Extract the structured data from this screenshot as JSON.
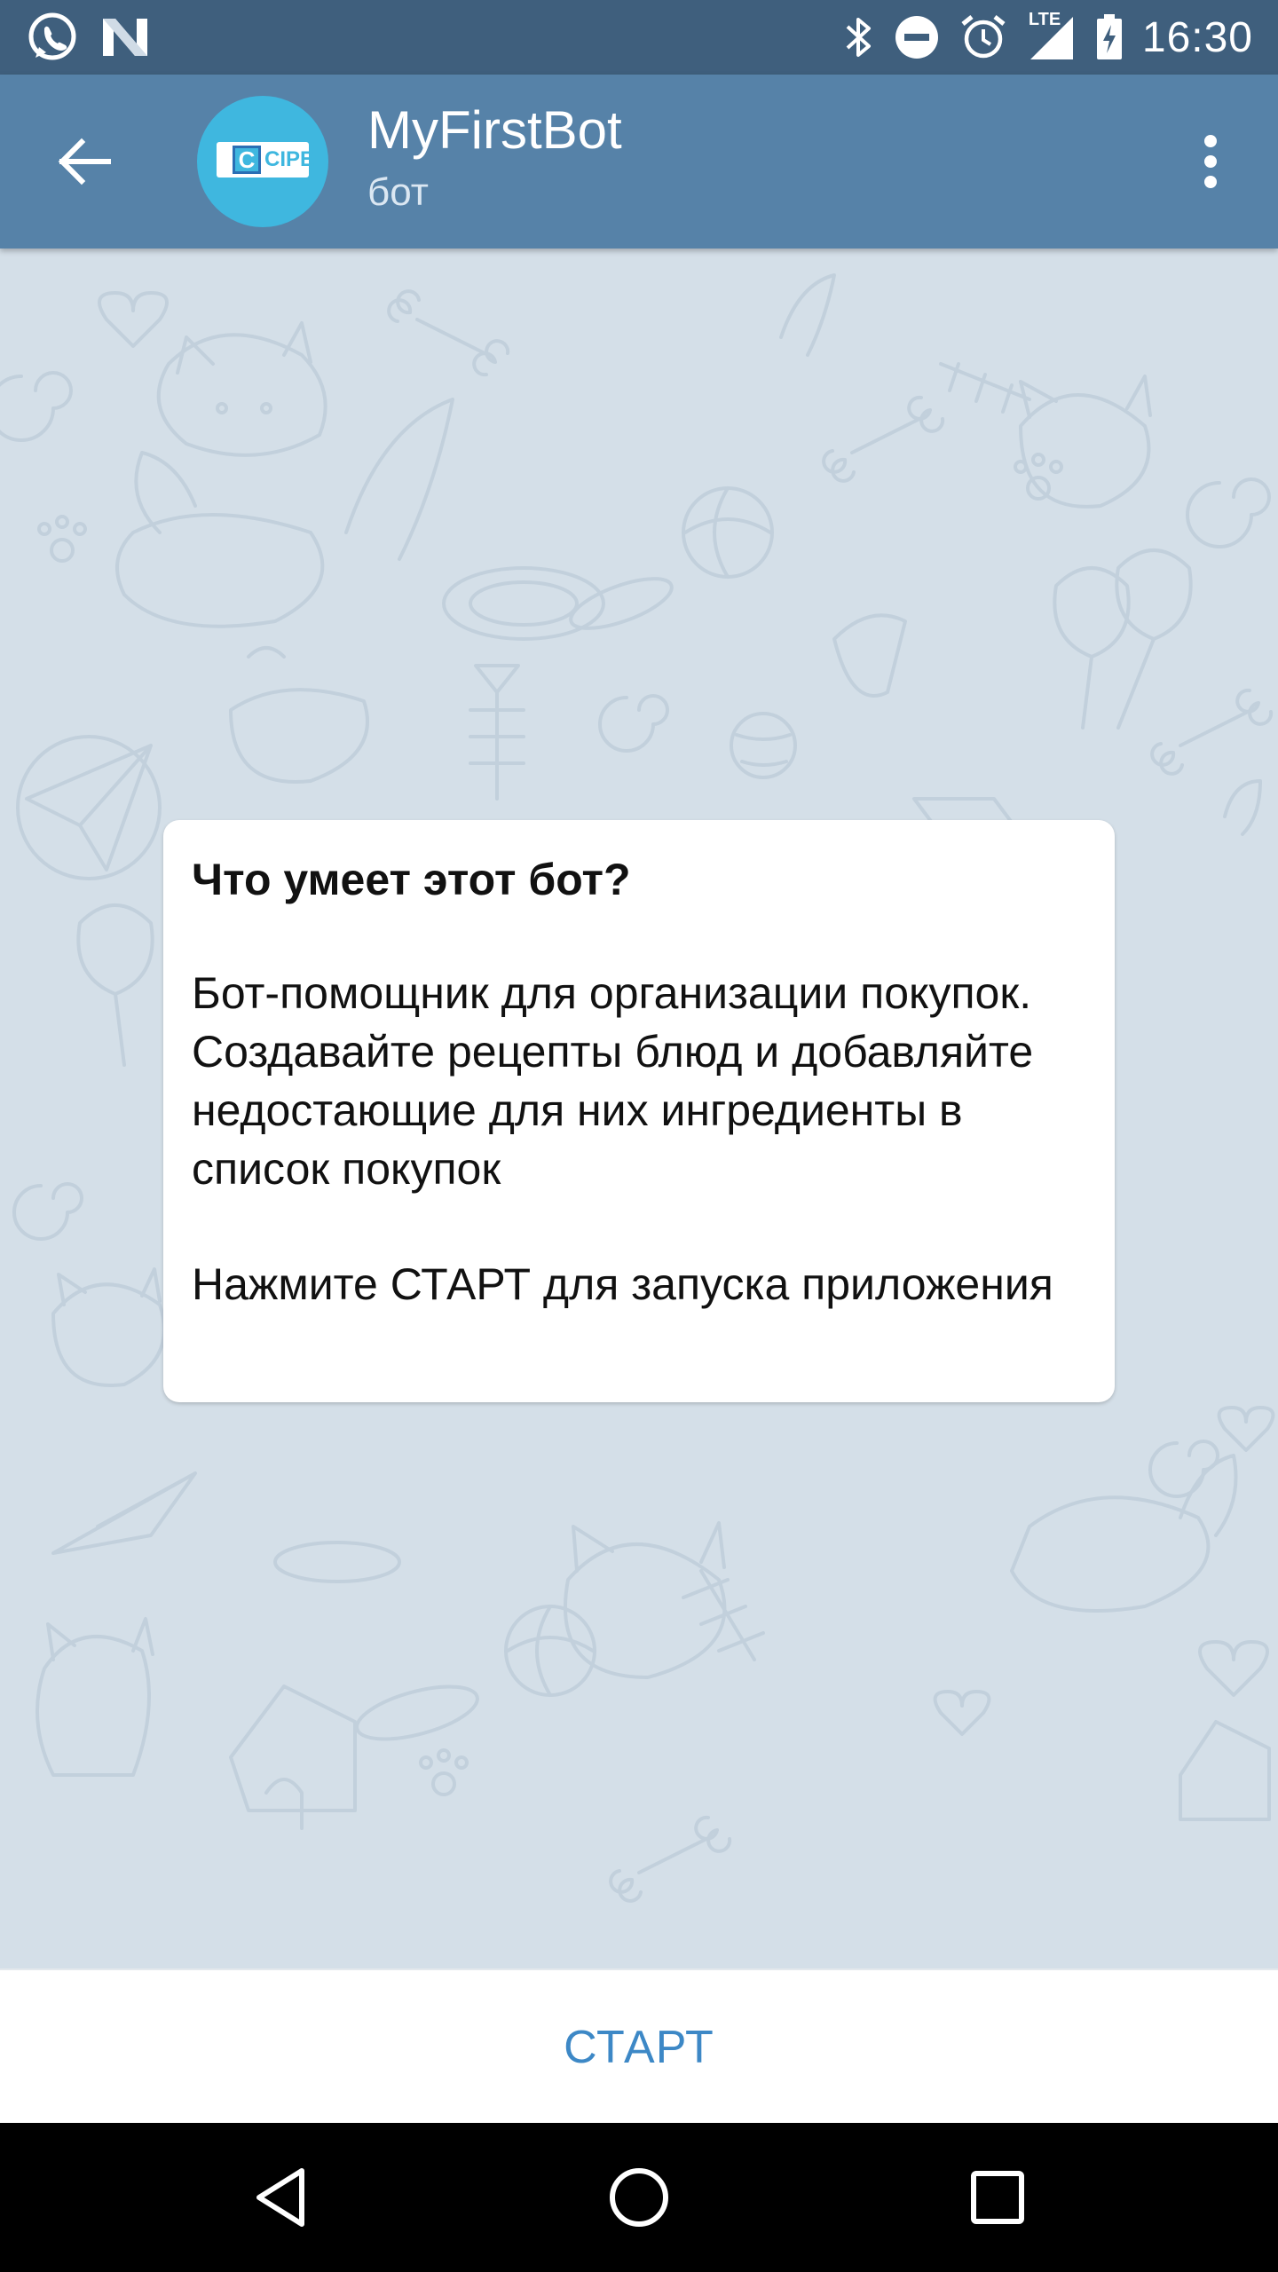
{
  "status_bar": {
    "time": "16:30",
    "network": "LTE",
    "left_icons": [
      "whatsapp-icon",
      "n-notification-icon"
    ],
    "right_icons": [
      "bluetooth-icon",
      "do-not-disturb-icon",
      "alarm-icon",
      "signal-icon",
      "battery-icon"
    ]
  },
  "header": {
    "title": "MyFirstBot",
    "subtitle": "бот",
    "avatar_text": "CIPE",
    "avatar_letter": "C",
    "avatar_color": "#3fb7df",
    "bar_color": "#5682a8"
  },
  "info_card": {
    "title": "Что умеет этот бот?",
    "description": "Бот-помощник для организации покупок. Создавайте рецепты блюд и добавляйте недостающие для них ингредиенты в список покупок",
    "hint": "Нажмите СТАРТ для запуска приложения"
  },
  "start_button": {
    "label": "СТАРТ",
    "color": "#3d88c6"
  },
  "nav_bar": {
    "items": [
      "back-triangle-icon",
      "home-circle-icon",
      "recents-square-icon"
    ]
  }
}
